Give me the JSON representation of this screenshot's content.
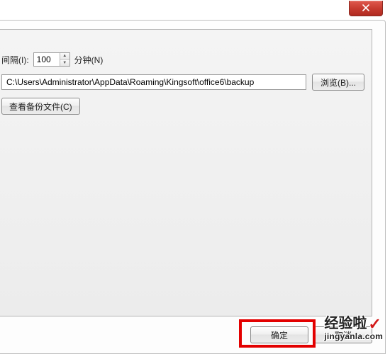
{
  "interval": {
    "label": "间隔(I):",
    "value": "100",
    "unit": "分钟(N)"
  },
  "path": {
    "value": "C:\\Users\\Administrator\\AppData\\Roaming\\Kingsoft\\office6\\backup",
    "browse_label": "浏览(B)..."
  },
  "view_backup_label": "查看备份文件(C)",
  "actions": {
    "ok_label": "确定",
    "cancel_label": "取消"
  },
  "watermark": {
    "brand": "经验啦",
    "url": "jingyanla.com"
  }
}
